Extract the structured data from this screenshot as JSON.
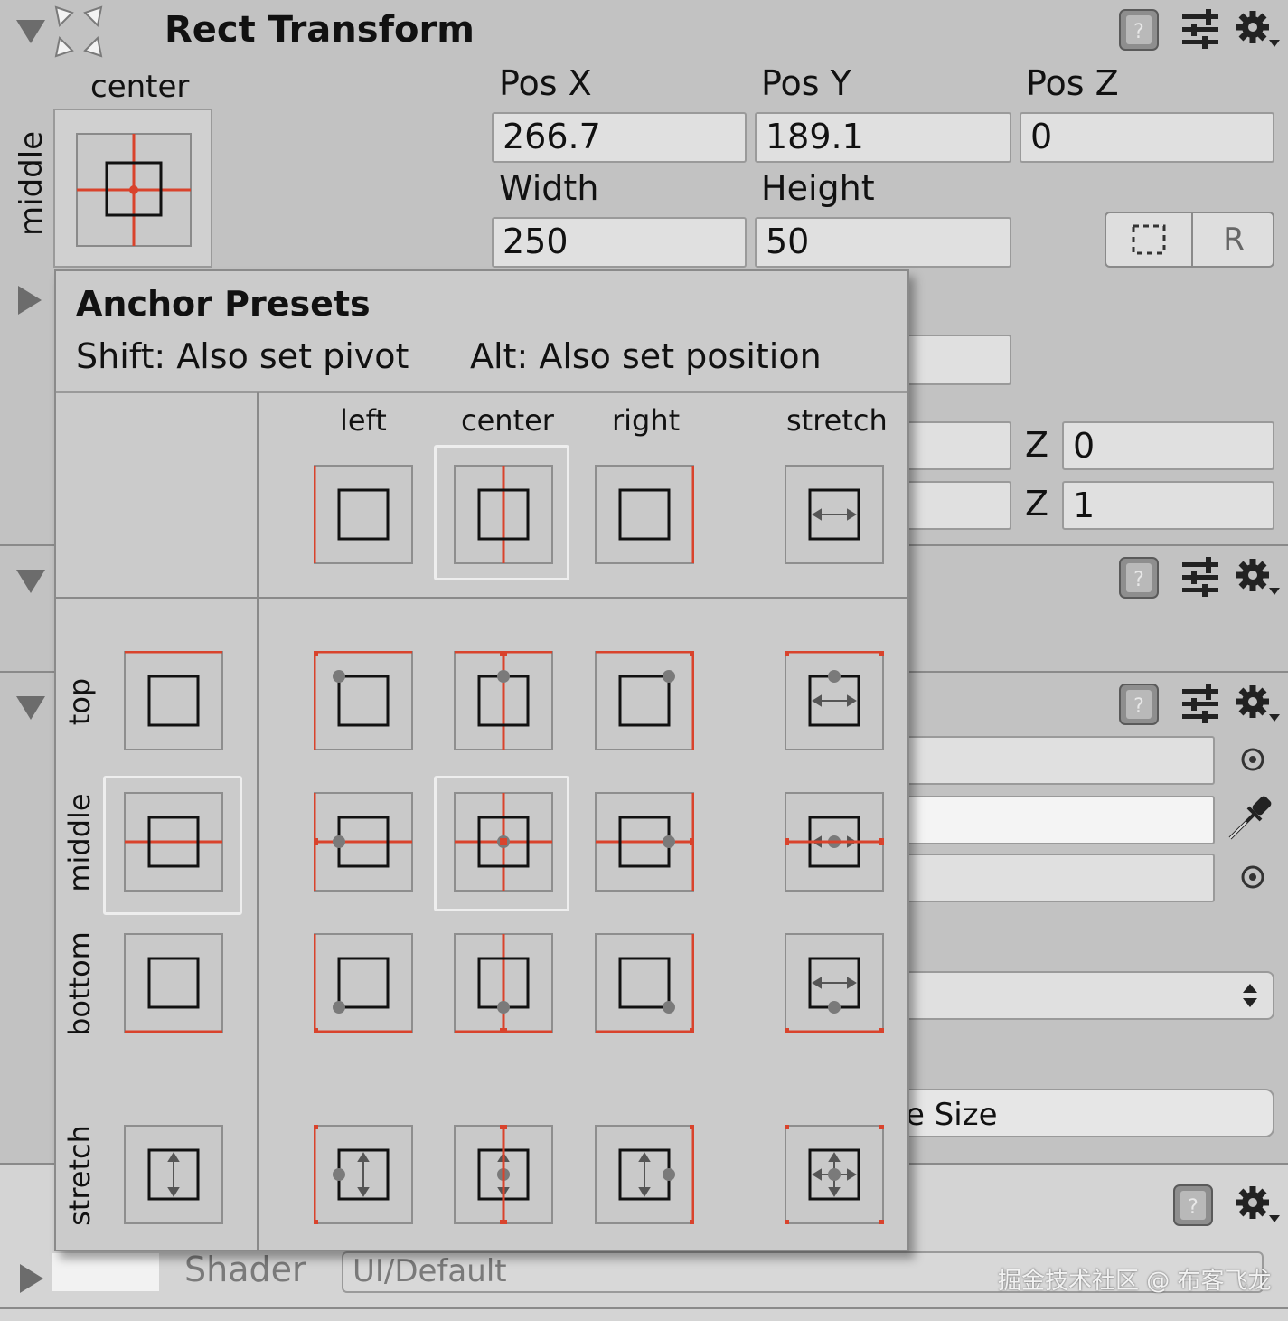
{
  "inspector": {
    "component_title": "Rect Transform",
    "anchor_h_label": "center",
    "anchor_v_label": "middle",
    "pos_x_label": "Pos X",
    "pos_y_label": "Pos Y",
    "pos_z_label": "Pos Z",
    "pos_x": "266.7",
    "pos_y": "189.1",
    "pos_z": "0",
    "width_label": "Width",
    "height_label": "Height",
    "width": "250",
    "height": "50",
    "raw_edit_label": "R",
    "rotation_z_label": "Z",
    "rotation_z": "0",
    "scale_z_label": "Z",
    "scale_z": "1",
    "native_size_label": "e Size",
    "shader_label": "Shader",
    "shader_value": "UI/Default"
  },
  "popup": {
    "title": "Anchor Presets",
    "shift_hint": "Shift: Also set pivot",
    "alt_hint": "Alt: Also set position",
    "columns": [
      "left",
      "center",
      "right",
      "stretch"
    ],
    "rows": [
      "top",
      "middle",
      "bottom",
      "stretch"
    ],
    "selected_column": "center",
    "selected_row": "middle"
  },
  "watermark": "掘金技术社区 @ 布客飞龙",
  "colors": {
    "panel_bg": "#c2c2c2",
    "popup_bg": "#cbcbcb",
    "anchor_line": "#d9432c",
    "pivot_dot": "#7a7a7a",
    "selected_outline": "#eeeeee"
  },
  "icons": [
    "help-book-icon",
    "preset-sliders-icon",
    "gear-icon",
    "foldout-arrow-icon",
    "anchor-target-icon",
    "eyedropper-icon",
    "blueprint-mode-icon"
  ]
}
